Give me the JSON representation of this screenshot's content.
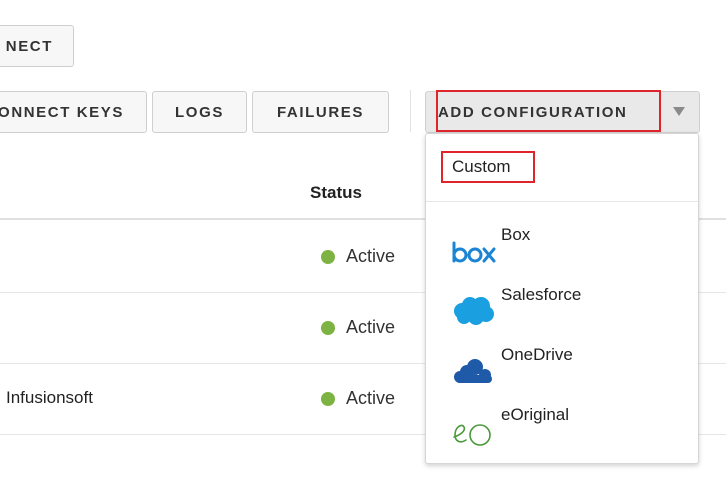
{
  "toolbar": {
    "connect_label": "NECT",
    "connect_keys_label": "ONNECT KEYS",
    "logs_label": "LOGS",
    "failures_label": "FAILURES",
    "add_configuration_label": "ADD CONFIGURATION"
  },
  "table": {
    "status_header": "Status",
    "rows": [
      {
        "name": "",
        "status": "Active"
      },
      {
        "name": "",
        "status": "Active"
      },
      {
        "name": "Infusionsoft",
        "status": "Active"
      }
    ]
  },
  "dropdown": {
    "custom_label": "Custom",
    "items": [
      {
        "label": "Box",
        "icon": "box-logo-icon"
      },
      {
        "label": "Salesforce",
        "icon": "salesforce-cloud-icon"
      },
      {
        "label": "OneDrive",
        "icon": "onedrive-cloud-icon"
      },
      {
        "label": "eOriginal",
        "icon": "eoriginal-logo-icon"
      }
    ]
  },
  "colors": {
    "active_dot": "#7cb342",
    "highlight": "#e0242c",
    "box_blue": "#1b84d4",
    "salesforce_blue": "#1a9fe0",
    "onedrive_blue": "#1e5aa8",
    "eoriginal_green": "#4a9a3a"
  }
}
